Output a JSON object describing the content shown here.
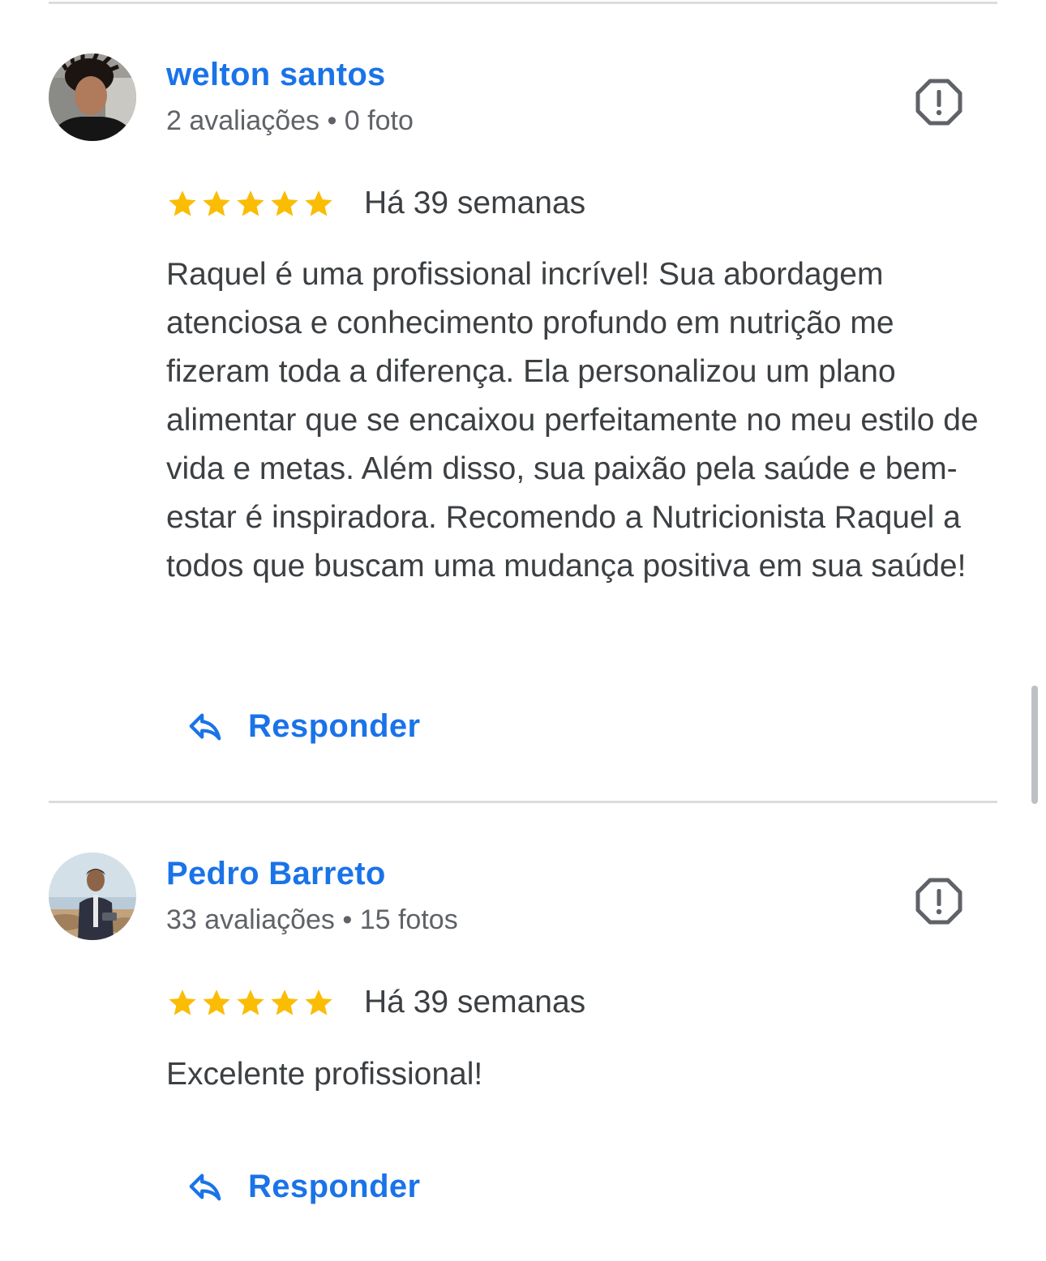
{
  "reviews": [
    {
      "author": "welton santos",
      "meta": "2 avaliações • 0 foto",
      "avatar_icon": "avatar-photo",
      "rating": 5,
      "time": "Há 39 semanas",
      "text": "Raquel é uma profissional incrível! Sua abordagem atenciosa e conhecimento profundo em nutrição me fizeram toda a diferença. Ela personalizou um plano alimentar que se encaixou perfeitamente no meu estilo de vida e metas. Além disso, sua paixão pela saúde e bem-estar é inspiradora. Recomendo a Nutricionista Raquel a todos que buscam uma mudança positiva em sua saúde!",
      "reply_label": "Responder"
    },
    {
      "author": "Pedro Barreto",
      "meta": "33 avaliações • 15 fotos",
      "avatar_icon": "avatar-photo",
      "rating": 5,
      "time": "Há 39 semanas",
      "text": "Excelente profissional!",
      "reply_label": "Responder"
    }
  ],
  "icons": {
    "report": "report-icon",
    "reply": "reply-arrow-icon",
    "star": "star-icon"
  },
  "colors": {
    "accent": "#1a73e8",
    "star": "#fbbc04",
    "text": "#3c4043",
    "secondary_text": "#5f6368",
    "divider": "#dadce0",
    "report_icon": "#5f6368"
  }
}
